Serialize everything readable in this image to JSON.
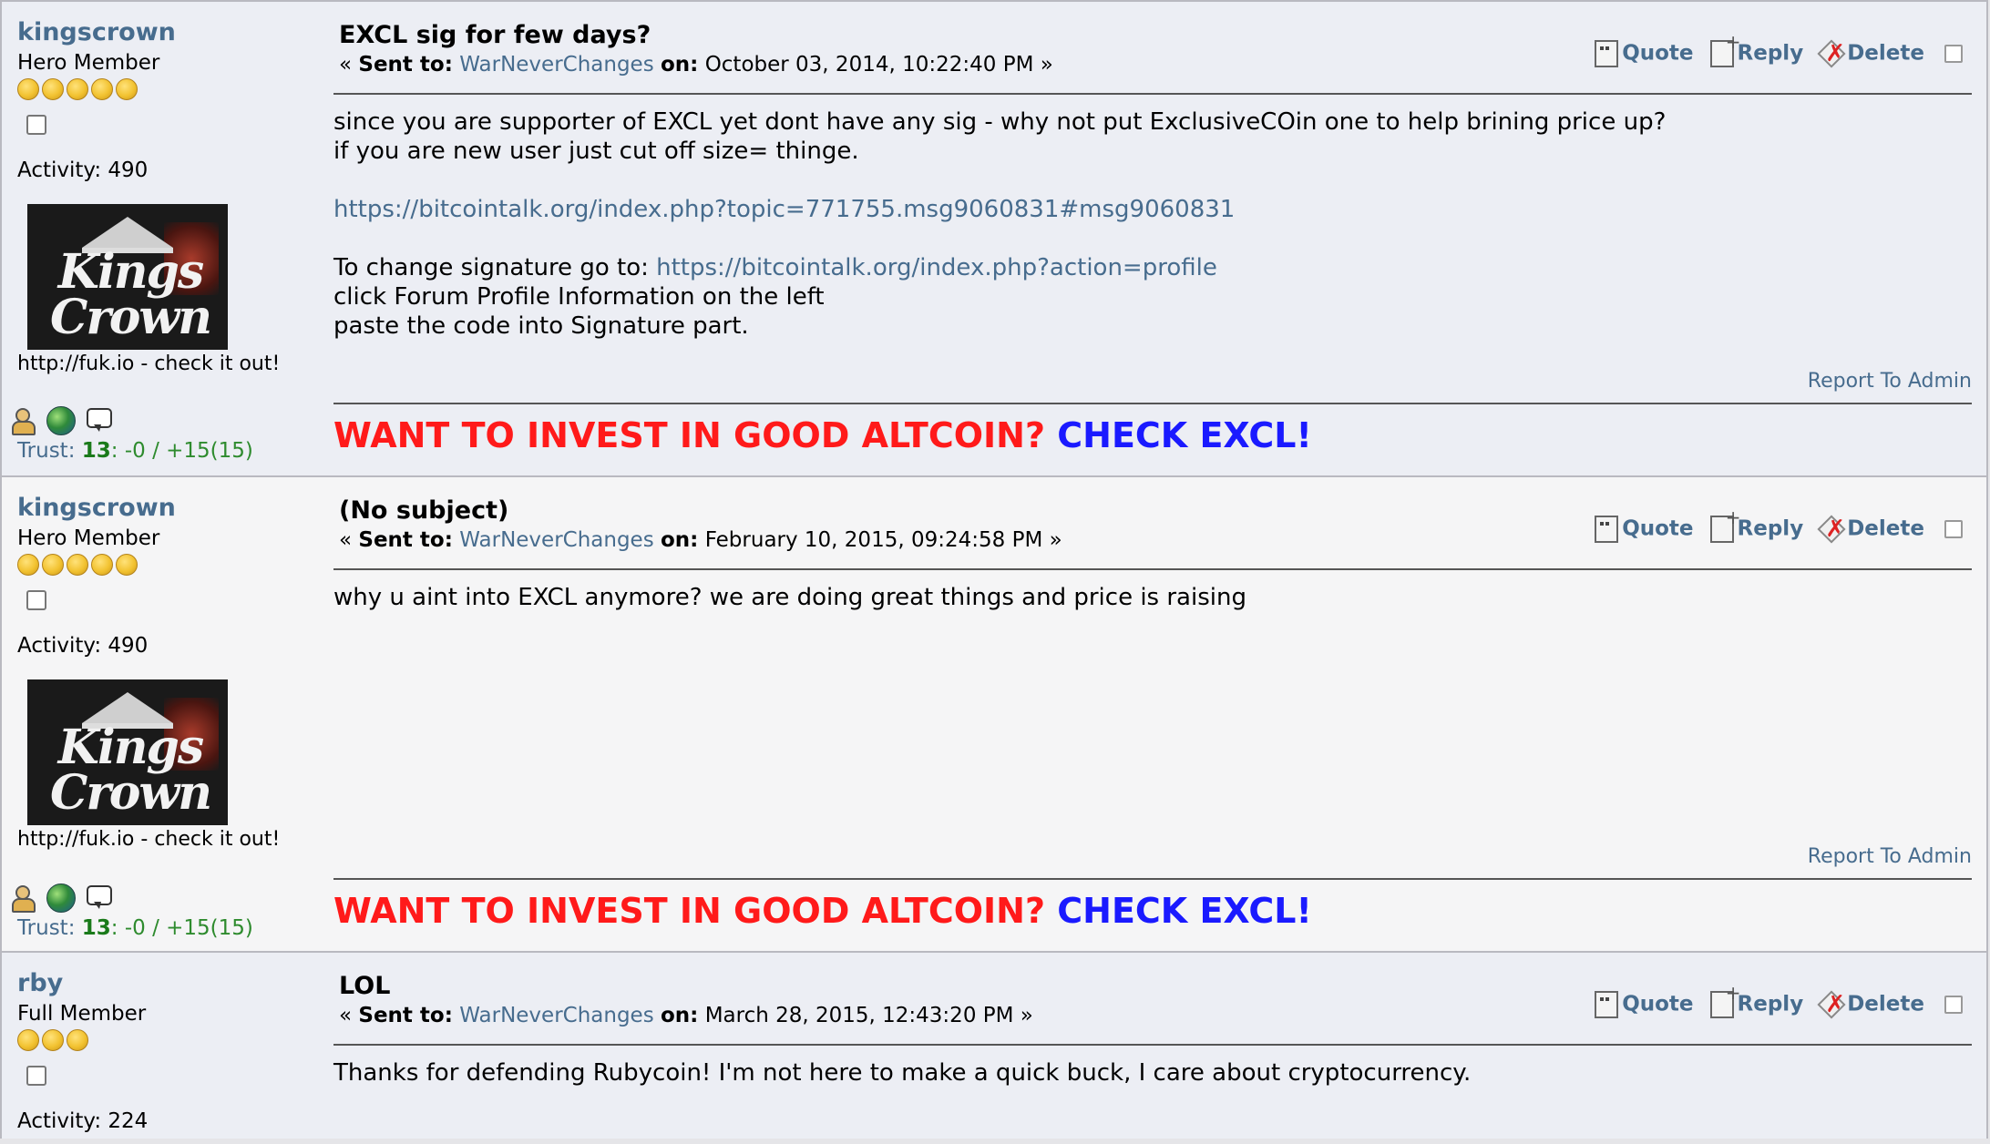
{
  "messages": [
    {
      "username": "kingscrown",
      "rank": "Hero Member",
      "stars": 5,
      "activity": "Activity: 490",
      "personal_text": "http://fuk.io - check it out!",
      "avatar_text": "Kings Crown",
      "trust": {
        "label": "Trust:",
        "score": "13",
        "detail": ": -0 / +15(15)"
      },
      "subject": "EXCL sig for few days?",
      "sent_prefix": "« ",
      "sent_to_label": "Sent to:",
      "recipient": "WarNeverChanges",
      "on_label": "on:",
      "date": "October 03, 2014, 10:22:40 PM »",
      "body": {
        "line1": "since you are supporter of EXCL yet dont have any sig - why not put ExclusiveCOin one to help brining price up?",
        "line2": "if you are new user just cut off size= thinge.",
        "link1": "https://bitcointalk.org/index.php?topic=771755.msg9060831#msg9060831",
        "line3": "To change signature go to: ",
        "link2": "https://bitcointalk.org/index.php?action=profile",
        "line4": "click Forum Profile Information on the left",
        "line5": "paste the code into Signature part."
      },
      "signature": {
        "red": "WANT TO INVEST IN GOOD ALTCOIN?",
        "blue": " CHECK EXCL!"
      }
    },
    {
      "username": "kingscrown",
      "rank": "Hero Member",
      "stars": 5,
      "activity": "Activity: 490",
      "personal_text": "http://fuk.io - check it out!",
      "avatar_text": "Kings Crown",
      "trust": {
        "label": "Trust:",
        "score": "13",
        "detail": ": -0 / +15(15)"
      },
      "subject": "(No subject)",
      "sent_prefix": "« ",
      "sent_to_label": "Sent to:",
      "recipient": "WarNeverChanges",
      "on_label": "on:",
      "date": "February 10, 2015, 09:24:58 PM »",
      "body": {
        "line1": "why u aint into EXCL anymore? we are doing great things and price is raising"
      },
      "signature": {
        "red": "WANT TO INVEST IN GOOD ALTCOIN?",
        "blue": " CHECK EXCL!"
      }
    },
    {
      "username": "rby",
      "rank": "Full Member",
      "stars": 3,
      "activity": "Activity: 224",
      "subject": "LOL",
      "sent_prefix": "« ",
      "sent_to_label": "Sent to:",
      "recipient": "WarNeverChanges",
      "on_label": "on:",
      "date": "March 28, 2015, 12:43:20 PM »",
      "body": {
        "line1": "Thanks for defending Rubycoin! I'm not here to make a quick buck, I care about cryptocurrency."
      }
    }
  ],
  "actions": {
    "quote": "Quote",
    "reply": "Reply",
    "delete": "Delete"
  },
  "report": "Report To Admin",
  "icons": {
    "star": "gold-coin-icon",
    "profile": "profile-icon",
    "www": "globe-icon",
    "pm": "speech-bubble-icon",
    "quote": "quote-icon",
    "reply": "reply-icon",
    "delete": "delete-icon"
  },
  "colors": {
    "link": "#476c8e",
    "sig_red": "#ff1a1a",
    "sig_blue": "#1a1aff",
    "trust_green": "#2e8b2e"
  }
}
